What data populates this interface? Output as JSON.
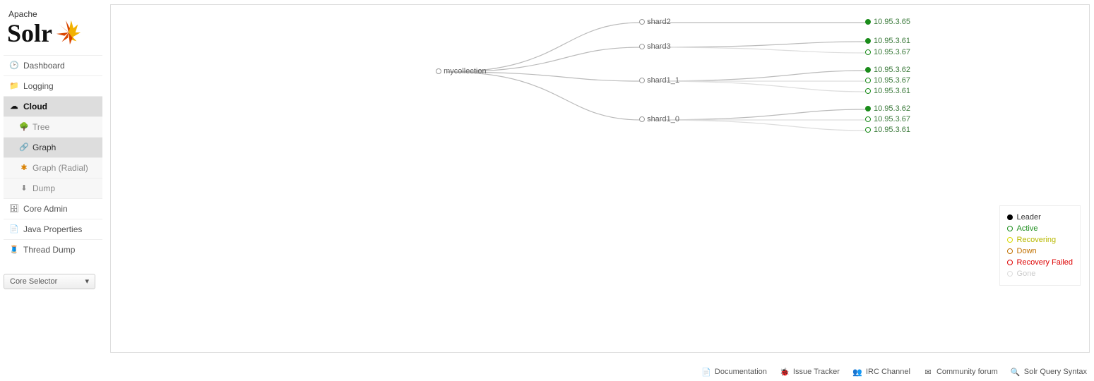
{
  "logo": {
    "line1": "Apache",
    "line2": "Solr"
  },
  "nav": {
    "dashboard": "Dashboard",
    "logging": "Logging",
    "cloud": "Cloud",
    "core_admin": "Core Admin",
    "java_props": "Java Properties",
    "thread_dump": "Thread Dump"
  },
  "subnav": {
    "tree": "Tree",
    "graph": "Graph",
    "graph_radial": "Graph (Radial)",
    "dump": "Dump"
  },
  "core_selector": {
    "label": "Core Selector"
  },
  "graph": {
    "collection": "mycollection",
    "shards": [
      {
        "name": "shard2",
        "replicas": [
          {
            "ip": "10.95.3.65",
            "state": "leader"
          }
        ]
      },
      {
        "name": "shard3",
        "replicas": [
          {
            "ip": "10.95.3.61",
            "state": "leader"
          },
          {
            "ip": "10.95.3.67",
            "state": "active"
          }
        ]
      },
      {
        "name": "shard1_1",
        "replicas": [
          {
            "ip": "10.95.3.62",
            "state": "leader"
          },
          {
            "ip": "10.95.3.67",
            "state": "active"
          },
          {
            "ip": "10.95.3.61",
            "state": "active"
          }
        ]
      },
      {
        "name": "shard1_0",
        "replicas": [
          {
            "ip": "10.95.3.62",
            "state": "leader"
          },
          {
            "ip": "10.95.3.67",
            "state": "active"
          },
          {
            "ip": "10.95.3.61",
            "state": "active"
          }
        ]
      }
    ]
  },
  "legend": {
    "leader": "Leader",
    "active": "Active",
    "recovering": "Recovering",
    "down": "Down",
    "recovery_failed": "Recovery Failed",
    "gone": "Gone"
  },
  "footer": {
    "documentation": "Documentation",
    "issue_tracker": "Issue Tracker",
    "irc": "IRC Channel",
    "forum": "Community forum",
    "query_syntax": "Solr Query Syntax"
  }
}
